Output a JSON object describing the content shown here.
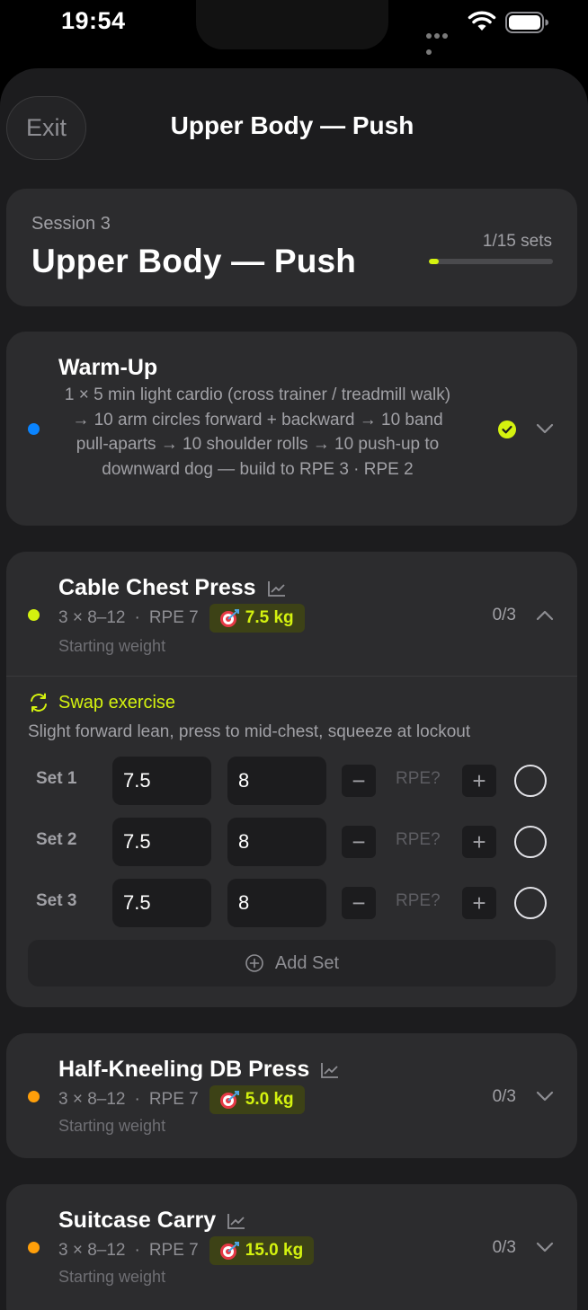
{
  "status": {
    "time": "19:54"
  },
  "nav": {
    "exit_label": "Exit",
    "title": "Upper Body — Push"
  },
  "session": {
    "label": "Session 3",
    "title": "Upper Body — Push",
    "sets_text": "1/15 sets",
    "progress_fraction": 0.0667
  },
  "warmup": {
    "name": "Warm-Up",
    "description": "1 × 5 min light cardio (cross trainer / treadmill walk) → 10 arm circles forward + backward → 10 band pull-aparts → 10 shoulder rolls → 10 push-up to downward dog — build to RPE 3  ·  RPE 2",
    "dot_color": "#0a84ff",
    "completed": true
  },
  "exercises": [
    {
      "name": "Cable Chest Press",
      "prescription": "3 × 8–12",
      "rpe": "RPE 7",
      "target": "7.5 kg",
      "sub": "Starting weight",
      "count": "0/3",
      "dot_color": "#d4f20f",
      "expanded": true,
      "swap_label": "Swap exercise",
      "cue": "Slight forward lean, press to mid-chest, squeeze at lockout",
      "sets": [
        {
          "label": "Set 1",
          "weight": "7.5",
          "reps": "8",
          "rpe_placeholder": "RPE?"
        },
        {
          "label": "Set 2",
          "weight": "7.5",
          "reps": "8",
          "rpe_placeholder": "RPE?"
        },
        {
          "label": "Set 3",
          "weight": "7.5",
          "reps": "8",
          "rpe_placeholder": "RPE?"
        }
      ],
      "add_set_label": "Add Set"
    },
    {
      "name": "Half-Kneeling DB Press",
      "prescription": "3 × 8–12",
      "rpe": "RPE 7",
      "target": "5.0 kg",
      "sub": "Starting weight",
      "count": "0/3",
      "dot_color": "#ff9f0a",
      "expanded": false
    },
    {
      "name": "Suitcase Carry",
      "prescription": "3 × 8–12",
      "rpe": "RPE 7",
      "target": "15.0 kg",
      "sub": "Starting weight",
      "count": "0/3",
      "dot_color": "#ff9f0a",
      "expanded": false
    }
  ],
  "symbols": {
    "sep": "·",
    "minus": "−",
    "plus": "+"
  },
  "colors": {
    "accent": "#d4f20f",
    "background": "#000000",
    "sheet": "#1c1c1e",
    "card": "#2c2c2e"
  }
}
